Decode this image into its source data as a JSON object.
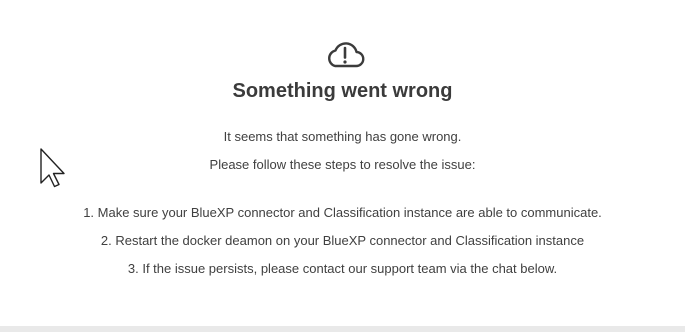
{
  "error": {
    "icon": "cloud-alert-icon",
    "title": "Something went wrong",
    "message_line_1": "It seems that something has gone wrong.",
    "message_line_2": "Please follow these steps to resolve the issue:",
    "steps": [
      "1. Make sure your BlueXP connector and Classification instance are able to communicate.",
      "2. Restart the docker deamon on your BlueXP connector and Classification instance",
      "3. If the issue persists, please contact our support team via the chat below."
    ]
  },
  "colors": {
    "text": "#404040",
    "title": "#3b3b3b",
    "background": "#ffffff",
    "bottom_bar": "#e9e9e9"
  }
}
